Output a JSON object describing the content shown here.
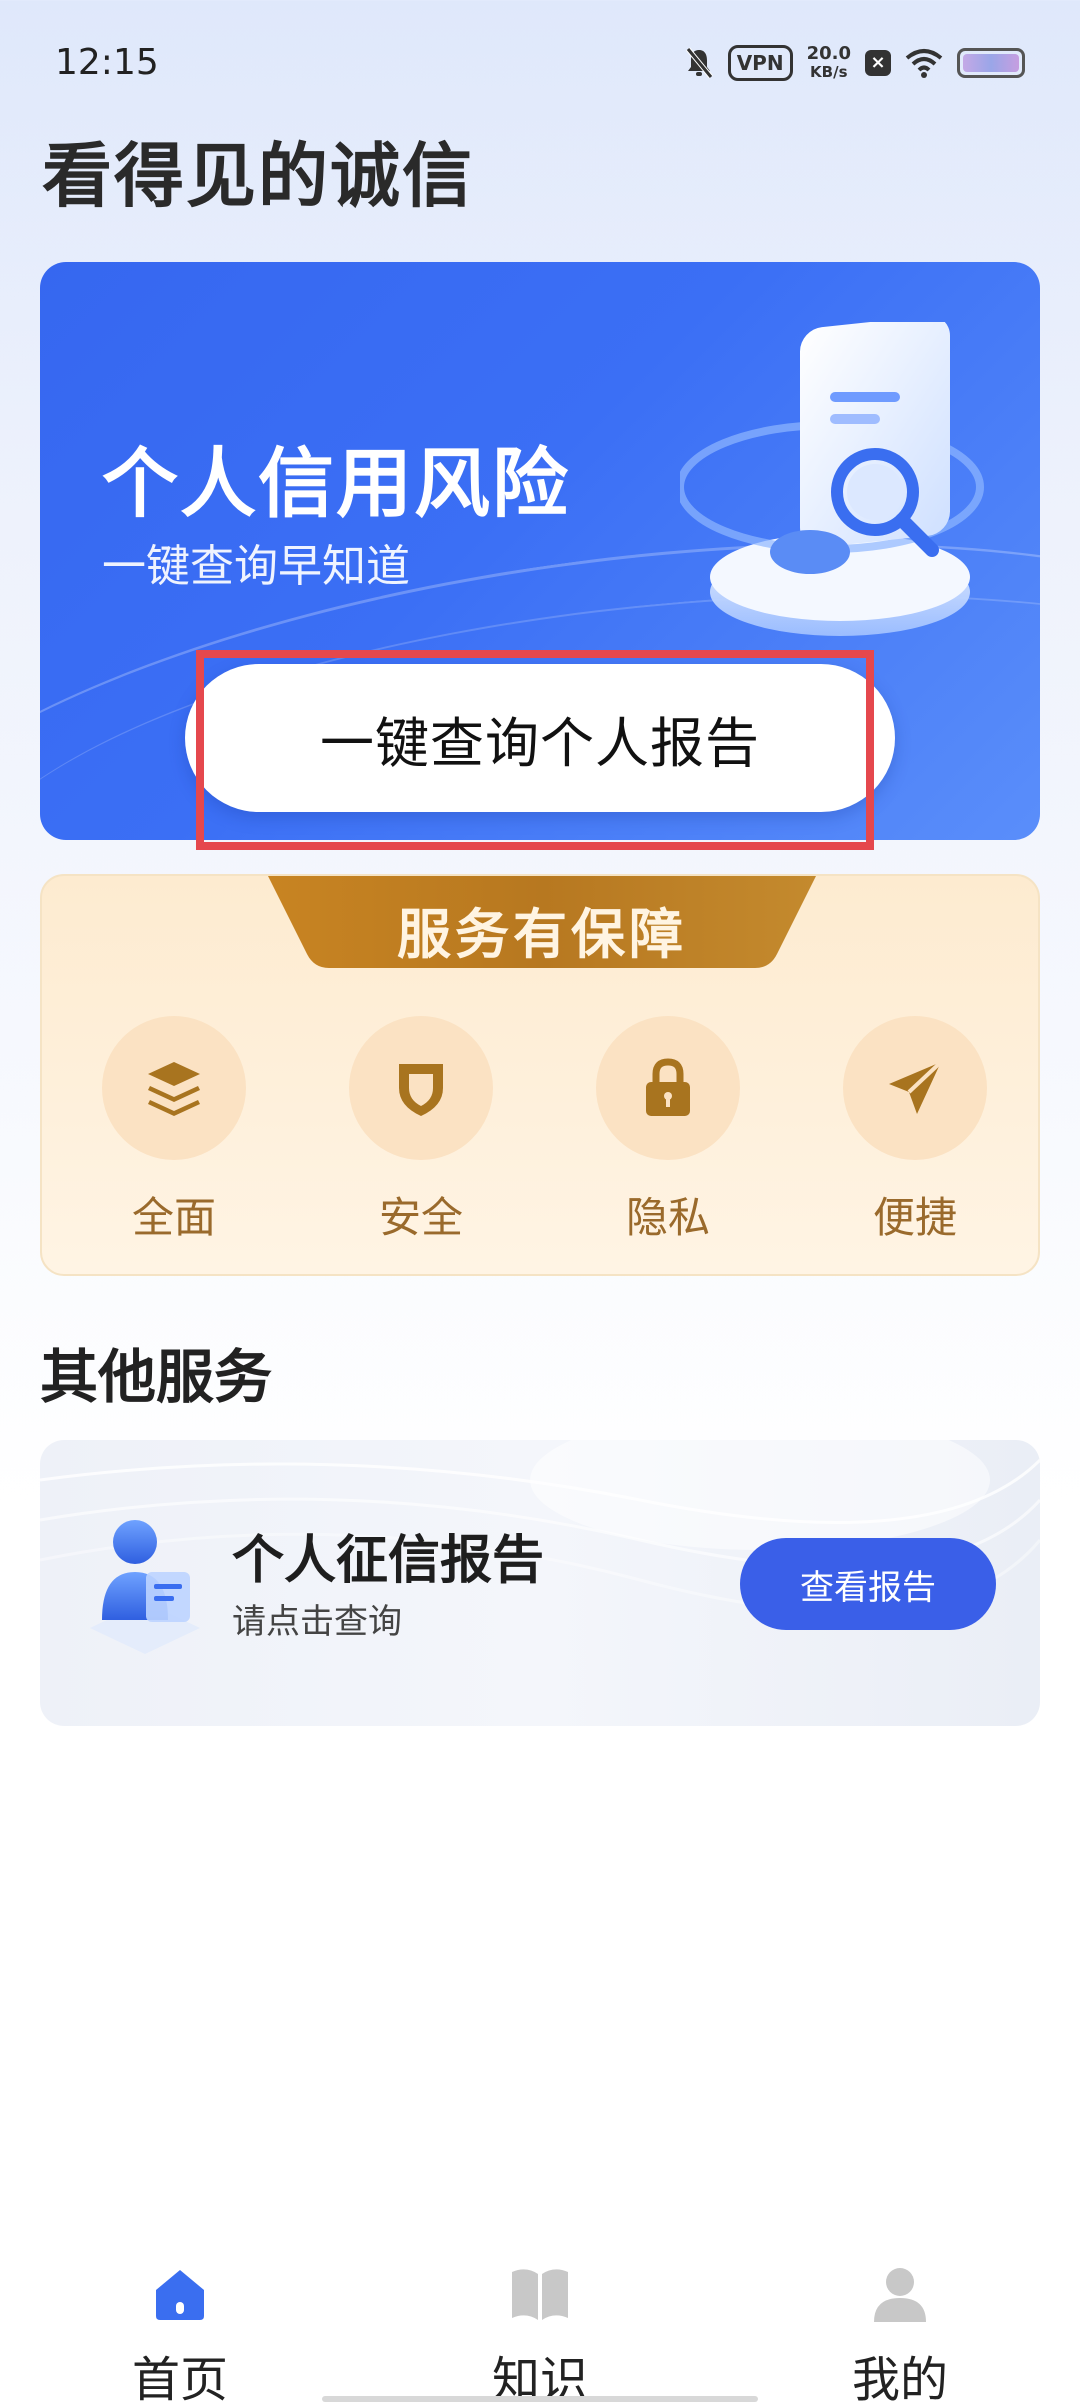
{
  "status_bar": {
    "time": "12:15",
    "vpn": "VPN",
    "net_speed_value": "20.0",
    "net_speed_unit": "KB/s"
  },
  "page": {
    "title": "看得见的诚信"
  },
  "hero": {
    "title": "个人信用风险",
    "subtitle": "一键查询早知道",
    "button_label": "一键查询个人报告",
    "colors": {
      "start": "#3667f0",
      "end": "#5a8efa"
    }
  },
  "guarantee": {
    "header": "服务有保障",
    "features": [
      {
        "label": "全面",
        "icon": "layers-icon"
      },
      {
        "label": "安全",
        "icon": "shield-icon"
      },
      {
        "label": "隐私",
        "icon": "lock-icon"
      },
      {
        "label": "便捷",
        "icon": "send-icon"
      }
    ],
    "accent": "#a8741f"
  },
  "other_services": {
    "section_title": "其他服务",
    "card": {
      "title": "个人征信报告",
      "subtitle": "请点击查询",
      "button_label": "查看报告"
    }
  },
  "bottom_nav": {
    "items": [
      {
        "label": "首页",
        "icon": "home-icon",
        "active": true
      },
      {
        "label": "知识",
        "icon": "book-icon",
        "active": false
      },
      {
        "label": "我的",
        "icon": "profile-icon",
        "active": false
      }
    ],
    "active_color": "#3a6ef0",
    "inactive_color": "#c8c8c8"
  },
  "annotation": {
    "highlight_color": "#e5484d"
  }
}
